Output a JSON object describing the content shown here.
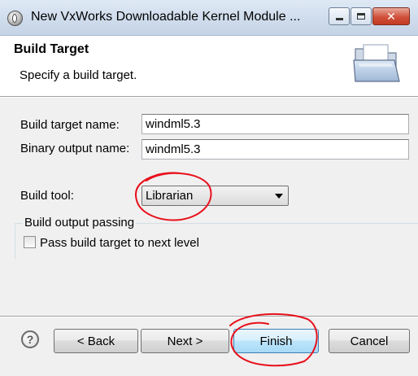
{
  "window": {
    "title": "New VxWorks Downloadable Kernel Module ...",
    "app_icon": "eclipse-icon",
    "controls": {
      "minimize": "minimize-icon",
      "maximize": "maximize-icon",
      "close": "✕"
    }
  },
  "header": {
    "title": "Build Target",
    "description": "Specify a build target.",
    "icon": "open-folder-icon"
  },
  "form": {
    "build_target_name": {
      "label": "Build target name:",
      "value": "windml5.3"
    },
    "binary_output_name": {
      "label": "Binary output name:",
      "value": "windml5.3"
    },
    "build_tool": {
      "label": "Build tool:",
      "selected": "Librarian"
    }
  },
  "group": {
    "title": "Build output passing",
    "checkbox": {
      "label": "Pass build target to next level",
      "checked": false
    }
  },
  "footer": {
    "help_icon": "?",
    "back": "< Back",
    "next": "Next >",
    "finish": "Finish",
    "cancel": "Cancel"
  },
  "colors": {
    "annotation": "#e8101c",
    "accent_border": "#3c7fb1"
  }
}
